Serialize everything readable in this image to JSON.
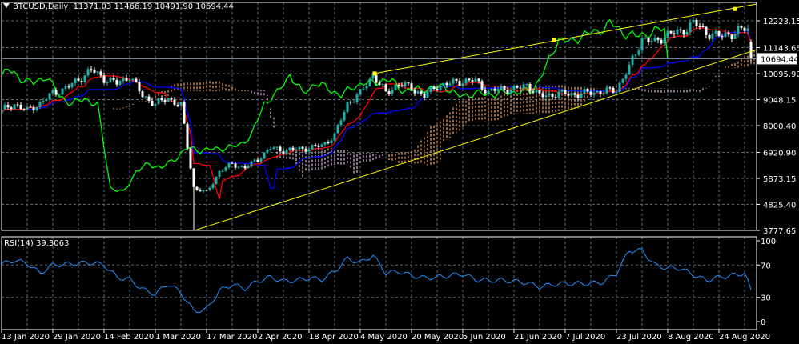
{
  "header": {
    "symbol": "BTCUSD,Daily",
    "open": "11371.03",
    "high": "11466.19",
    "low": "10491.90",
    "close": "10694.44"
  },
  "rsi_label": {
    "name": "RSI(14)",
    "value": "39.3063"
  },
  "colors": {
    "bull": "#20b2aa",
    "bear": "#ffffff",
    "tenkan": "#ff0000",
    "kijun": "#0000ff",
    "chikou": "#00ff00",
    "cloud_up": "#f4a460",
    "cloud_down": "#d8bfd8",
    "trendline": "#ffff00",
    "rsi": "#1e90ff",
    "grid": "#5a6a7a"
  },
  "chart_data": [
    {
      "type": "candlestick",
      "title": "BTCUSD,Daily",
      "x_unit": "days since 13 Jan 2020",
      "anchor_step_days": 4,
      "closes": [
        8600,
        8870,
        8600,
        8900,
        9300,
        9500,
        9840,
        10250,
        9900,
        9700,
        10000,
        9200,
        8870,
        9100,
        8800,
        5500,
        5300,
        6150,
        6450,
        6300,
        6650,
        7100,
        7000,
        7050,
        7100,
        7200,
        7600,
        8900,
        9300,
        10050,
        9300,
        9700,
        9500,
        9200,
        9600,
        9700,
        9800,
        9800,
        9350,
        9500,
        9450,
        9650,
        9200,
        9250,
        9300,
        9250,
        9350,
        9350,
        9450,
        10350,
        11500,
        11350,
        11700,
        11750,
        12150,
        11750,
        11600,
        11700,
        11900
      ],
      "last_bar": {
        "day": 234,
        "open": 11371.03,
        "high": 11466.19,
        "low": 10491.9,
        "close": 10694.44
      },
      "extreme_low": {
        "day": 60,
        "price": 3777.65
      },
      "ylim": [
        3777.65,
        12650
      ],
      "y_ticks": [
        "12223.15",
        "11143.65",
        "10095.90",
        "9048.15",
        "8000.40",
        "6920.90",
        "5873.15",
        "4825.40",
        "3777.65"
      ],
      "current_price_label": "10694.44",
      "x_ticks": [
        "13 Jan 2020",
        "29 Jan 2020",
        "14 Feb 2020",
        "1 Mar 2020",
        "17 Mar 2020",
        "2 Apr 2020",
        "18 Apr 2020",
        "4 May 2020",
        "20 May 2020",
        "5 Jun 2020",
        "21 Jun 2020",
        "7 Jul 2020",
        "23 Jul 2020",
        "8 Aug 2020",
        "24 Aug 2020"
      ],
      "indicators": [
        "Ichimoku (tenkan, kijun, senkou span A/B cloud, chikou)"
      ],
      "trendlines": [
        {
          "name": "upper",
          "from": {
            "day": 116.5,
            "price": 10100
          },
          "to": {
            "day": 235.75,
            "price": 12900
          },
          "markers": [
            {
              "day": 116.5,
              "price": 10100
            },
            {
              "day": 172.5,
              "price": 11450
            },
            {
              "day": 229,
              "price": 12700
            }
          ]
        },
        {
          "name": "lower",
          "from": {
            "day": 60.25,
            "price": 3777.65
          },
          "to": {
            "day": 235.75,
            "price": 11060
          }
        }
      ]
    },
    {
      "type": "line",
      "title": "RSI(14)",
      "anchor_step_days": 4,
      "values": [
        71,
        76,
        72,
        60,
        70,
        71,
        72,
        73,
        70,
        55,
        52,
        40,
        34,
        47,
        36,
        13,
        15,
        38,
        46,
        41,
        50,
        55,
        50,
        51,
        54,
        52,
        62,
        78,
        73,
        82,
        60,
        62,
        57,
        54,
        55,
        57,
        59,
        52,
        51,
        51,
        50,
        48,
        43,
        46,
        47,
        47,
        47,
        49,
        60,
        88,
        88,
        70,
        66,
        66,
        58,
        51,
        55,
        57,
        60
      ],
      "last": {
        "day": 234,
        "value": 39.3063
      },
      "ylim": [
        0,
        100
      ],
      "y_ticks": [
        "100",
        "70",
        "30",
        "0"
      ],
      "levels": [
        70,
        30
      ]
    }
  ]
}
